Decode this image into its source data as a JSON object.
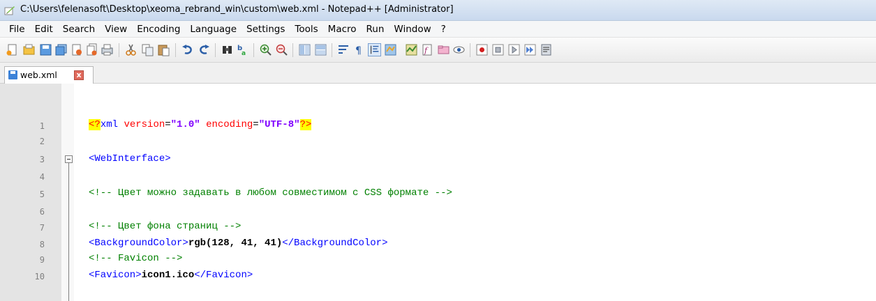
{
  "window": {
    "title": "C:\\Users\\felenasoft\\Desktop\\xeoma_rebrand_win\\custom\\web.xml - Notepad++ [Administrator]"
  },
  "menu": [
    "File",
    "Edit",
    "Search",
    "View",
    "Encoding",
    "Language",
    "Settings",
    "Tools",
    "Macro",
    "Run",
    "Window",
    "?"
  ],
  "toolbar_icons": [
    "new-file-icon",
    "open-file-icon",
    "save-icon",
    "save-all-icon",
    "close-icon",
    "close-all-icon",
    "print-icon",
    "cut-icon",
    "copy-icon",
    "paste-icon",
    "undo-icon",
    "redo-icon",
    "find-icon",
    "replace-icon",
    "zoom-in-icon",
    "zoom-out-icon",
    "sync-vertical-icon",
    "sync-horizontal-icon",
    "word-wrap-icon",
    "show-all-characters-icon",
    "indent-guide-icon",
    "user-defined-language-icon",
    "document-map-icon",
    "function-list-icon",
    "folder-as-workspace-icon",
    "monitoring-icon",
    "record-macro-icon",
    "stop-recording-icon",
    "play-macro-icon",
    "run-macro-multiple-icon",
    "save-macro-icon"
  ],
  "tab": {
    "label": "web.xml",
    "close_label": "x"
  },
  "editor": {
    "line_numbers": [
      "1",
      "2",
      "3",
      "4",
      "5",
      "6",
      "7",
      "8",
      "9",
      "10"
    ],
    "lines": {
      "l1": {
        "open": "<?",
        "name": "xml",
        "a1": "version",
        "eq1": "=",
        "v1": "\"1.0\"",
        "a2": "encoding",
        "eq2": "=",
        "v2": "\"UTF-8\"",
        "close": "?>"
      },
      "l3": "<WebInterface>",
      "l5": "<!-- Цвет можно задавать в любом совместимом с CSS формате -->",
      "l7": "<!-- Цвет фона страниц -->",
      "l8": {
        "open": "<BackgroundColor>",
        "text": "rgb(128, 41, 41)",
        "close": "</BackgroundColor>"
      },
      "l9": "<!-- Favicon -->",
      "l10": {
        "open": "<Favicon>",
        "text": "icon1.ico",
        "close": "</Favicon>"
      }
    }
  },
  "colors": {
    "comment": "#008000",
    "tag": "#0000ff",
    "attribute": "#ff0000",
    "value": "#8000ff",
    "pi_highlight": "#ffff00"
  }
}
